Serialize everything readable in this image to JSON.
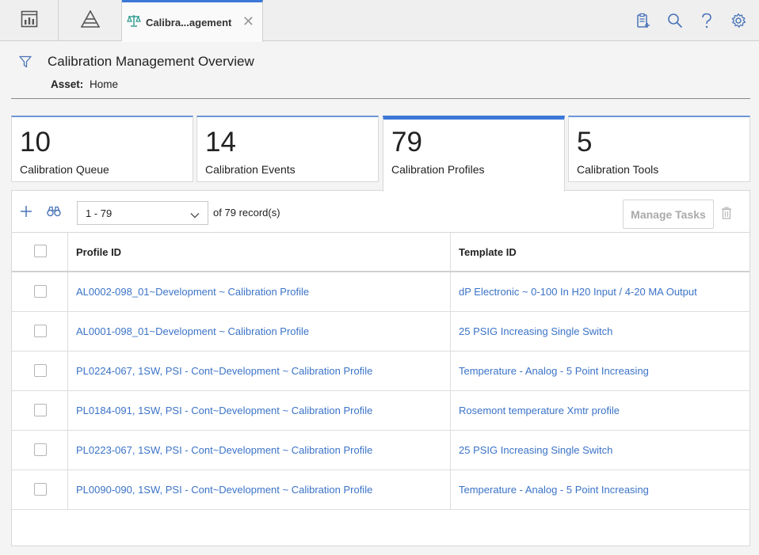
{
  "tabs": {
    "active_title": "Calibra...agement"
  },
  "header": {
    "title": "Calibration Management Overview",
    "asset_label": "Asset:",
    "asset_value": "Home"
  },
  "tiles": [
    {
      "count": "10",
      "label": "Calibration Queue"
    },
    {
      "count": "14",
      "label": "Calibration Events"
    },
    {
      "count": "79",
      "label": "Calibration Profiles"
    },
    {
      "count": "5",
      "label": "Calibration Tools"
    }
  ],
  "toolbar": {
    "range": "1 - 79",
    "of_text": "of",
    "total": "79",
    "records_text": "record(s)",
    "manage_tasks": "Manage Tasks"
  },
  "grid": {
    "columns": [
      "Profile ID",
      "Template ID"
    ],
    "rows": [
      {
        "profile": "AL0002-098_01~Development ~ Calibration Profile",
        "template": "dP Electronic ~ 0-100 In H20 Input / 4-20 MA Output"
      },
      {
        "profile": "AL0001-098_01~Development ~ Calibration Profile",
        "template": "25 PSIG Increasing Single Switch"
      },
      {
        "profile": "PL0224-067, 1SW, PSI - Cont~Development ~ Calibration Profile",
        "template": "Temperature - Analog - 5 Point Increasing"
      },
      {
        "profile": "PL0184-091, 1SW, PSI - Cont~Development ~ Calibration Profile",
        "template": "Rosemont temperature Xmtr profile"
      },
      {
        "profile": "PL0223-067, 1SW, PSI - Cont~Development ~ Calibration Profile",
        "template": "25 PSIG Increasing Single Switch"
      },
      {
        "profile": "PL0090-090, 1SW, PSI - Cont~Development ~ Calibration Profile",
        "template": "Temperature - Analog - 5 Point Increasing"
      }
    ]
  },
  "colors": {
    "accent": "#3c78d8",
    "link": "#3b73c7",
    "teal_icon": "#2a9a8e"
  },
  "icons": [
    "dashboard-icon",
    "pyramid-icon",
    "scale-icon",
    "close-icon",
    "clipboard-add-icon",
    "search-icon",
    "help-icon",
    "gear-icon",
    "filter-icon",
    "add-icon",
    "binoculars-icon",
    "chevron-down-icon",
    "trash-icon"
  ]
}
